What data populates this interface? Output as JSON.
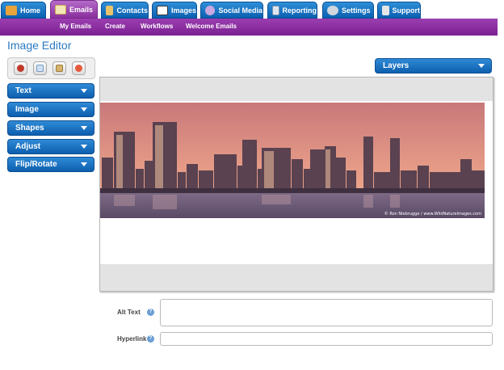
{
  "tabs": [
    {
      "label": "Home",
      "icon": "home-icon",
      "active": false
    },
    {
      "label": "Emails",
      "icon": "envelope-icon",
      "active": true
    },
    {
      "label": "Contacts",
      "icon": "contacts-icon",
      "active": false
    },
    {
      "label": "Images",
      "icon": "images-icon",
      "active": false
    },
    {
      "label": "Social Media",
      "icon": "social-media-icon",
      "active": false
    },
    {
      "label": "Reporting",
      "icon": "reporting-icon",
      "active": false
    },
    {
      "label": "Settings",
      "icon": "gear-icon",
      "active": false
    },
    {
      "label": "Support",
      "icon": "wrench-icon",
      "active": false
    }
  ],
  "subnav": {
    "items": [
      "My Emails",
      "Create",
      "Workflows",
      "Welcome Emails"
    ]
  },
  "page": {
    "title": "Image Editor"
  },
  "toolbar": {
    "icons": [
      "cut-icon",
      "copy-icon",
      "paste-icon",
      "delete-icon"
    ]
  },
  "accordion": {
    "items": [
      "Text",
      "Image",
      "Shapes",
      "Adjust",
      "Flip/Rotate"
    ]
  },
  "layers": {
    "label": "Layers"
  },
  "image": {
    "credit": "© Ron Niebrugge / www.WildNatureImages.com"
  },
  "form": {
    "alt_text_label": "Alt Text",
    "alt_text_value": "",
    "hyperlink_label": "Hyperlink",
    "hyperlink_value": "",
    "help_glyph": "?"
  },
  "colors": {
    "tab_blue": "#1470c4",
    "active_purple": "#8a2f9e",
    "subnav_purple": "#8a2ea3",
    "title_blue": "#2a7ac2"
  }
}
